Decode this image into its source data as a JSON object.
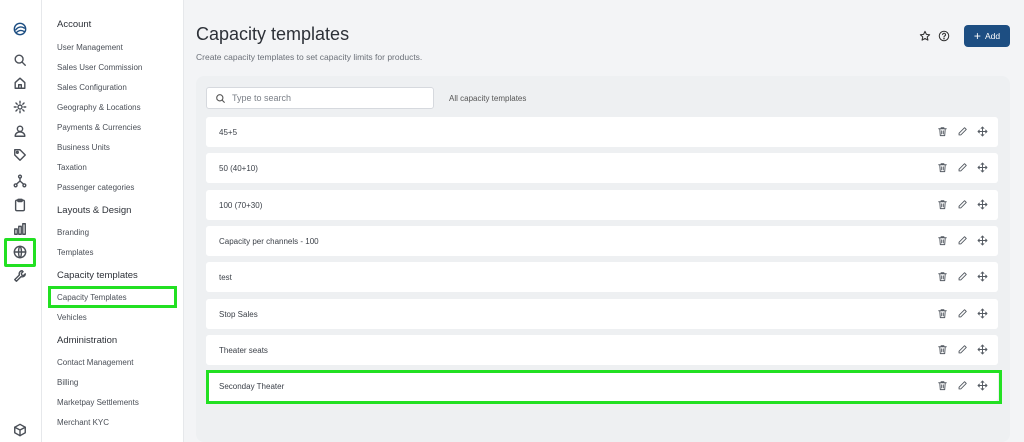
{
  "sidebar": {
    "sections": [
      {
        "title": "Account",
        "items": [
          "User Management",
          "Sales User Commission",
          "Sales Configuration",
          "Geography & Locations",
          "Payments & Currencies",
          "Business Units",
          "Taxation",
          "Passenger categories"
        ]
      },
      {
        "title": "Layouts & Design",
        "items": [
          "Branding",
          "Templates"
        ]
      },
      {
        "title": "Capacity templates",
        "items": [
          "Capacity Templates",
          "Vehicles"
        ]
      },
      {
        "title": "Administration",
        "items": [
          "Contact Management",
          "Billing",
          "Marketpay Settlements",
          "Merchant KYC"
        ]
      }
    ],
    "active_item": "Capacity Templates"
  },
  "rail_icons": [
    "logo-icon",
    "search-icon",
    "home-icon",
    "settings-icon",
    "user-icon",
    "tag-icon",
    "network-icon",
    "clipboard-icon",
    "bar-chart-icon",
    "globe-icon",
    "wrench-icon",
    "cube-icon"
  ],
  "header": {
    "title": "Capacity templates",
    "subtitle": "Create capacity templates to set capacity limits for products.",
    "add_label": "Add"
  },
  "search": {
    "placeholder": "Type to search",
    "value": ""
  },
  "filter_label": "All capacity templates",
  "templates": [
    "45+5",
    "50 (40+10)",
    "100 (70+30)",
    "Capacity per channels - 100",
    "test",
    "Stop Sales",
    "Theater seats",
    "Seconday Theater"
  ],
  "colors": {
    "accent": "#1d4e82",
    "highlight": "#22e022"
  }
}
